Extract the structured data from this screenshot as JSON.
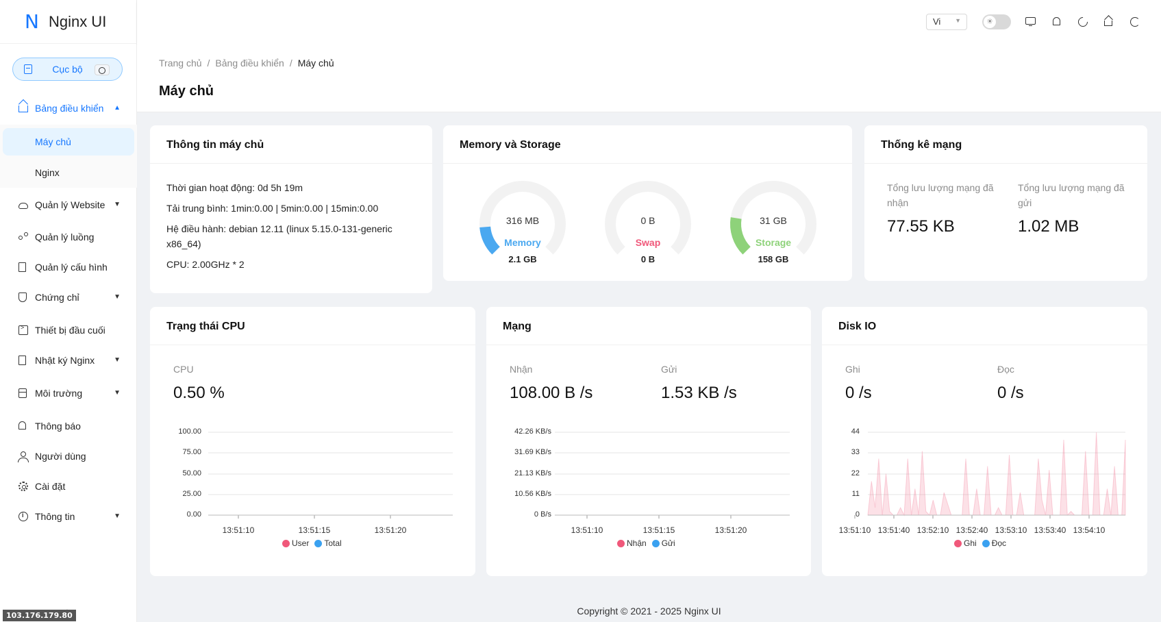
{
  "app": {
    "logo_letter": "N",
    "title": "Nginx UI"
  },
  "sidebar": {
    "node_label": "Cục bộ",
    "items": [
      {
        "label": "Bảng điều khiển",
        "icon": "home-icon",
        "open": true
      },
      {
        "label": "Máy chủ",
        "sub": true,
        "active": true
      },
      {
        "label": "Nginx",
        "sub": true
      },
      {
        "label": "Quản lý Website",
        "icon": "cloud-icon",
        "chevron": true
      },
      {
        "label": "Quản lý luồng",
        "icon": "share-icon"
      },
      {
        "label": "Quản lý cấu hình",
        "icon": "file-icon"
      },
      {
        "label": "Chứng chỉ",
        "icon": "shield-icon",
        "chevron": true
      },
      {
        "label": "Thiết bị đầu cuối",
        "icon": "terminal-icon"
      },
      {
        "label": "Nhật ký Nginx",
        "icon": "file-text-icon",
        "chevron": true
      },
      {
        "label": "Môi trường",
        "icon": "database-icon",
        "chevron": true
      },
      {
        "label": "Thông báo",
        "icon": "bell-icon"
      },
      {
        "label": "Người dùng",
        "icon": "user-icon"
      },
      {
        "label": "Cài đặt",
        "icon": "gear-icon"
      },
      {
        "label": "Thông tin",
        "icon": "info-icon",
        "chevron": true
      }
    ],
    "ip": "103.176.179.80"
  },
  "header": {
    "lang": "Vi"
  },
  "breadcrumb": [
    "Trang chủ",
    "Bảng điều khiển",
    "Máy chủ"
  ],
  "page_title": "Máy chủ",
  "server_info": {
    "title": "Thông tin máy chủ",
    "uptime": "Thời gian hoạt động: 0d 5h 19m",
    "load": "Tải trung bình: 1min:0.00 | 5min:0.00 | 15min:0.00",
    "os_line1": "Hệ điều hành: debian 12.11 (linux 5.15.0-131-generic",
    "os_line2": "x86_64)",
    "cpu": "CPU: 2.00GHz * 2"
  },
  "memory": {
    "title": "Memory và Storage",
    "gauges": [
      {
        "value": "316 MB",
        "name": "Memory",
        "total": "2.1 GB",
        "percent": 15,
        "color": "#4aa8f0"
      },
      {
        "value": "0 B",
        "name": "Swap",
        "total": "0 B",
        "percent": 0,
        "color": "#f0587a"
      },
      {
        "value": "31 GB",
        "name": "Storage",
        "total": "158 GB",
        "percent": 20,
        "color": "#8ed27a"
      }
    ]
  },
  "network_stats": {
    "title": "Thống kê mạng",
    "recv_label_1": "Tổng lưu lượng mạng đã",
    "recv_label_2": "nhận",
    "recv_value": "77.55 KB",
    "sent_label_1": "Tổng lưu lượng mạng đã",
    "sent_label_2": "gửi",
    "sent_value": "1.02 MB"
  },
  "cpu_card": {
    "title": "Trạng thái CPU",
    "label": "CPU",
    "value": "0.50 %",
    "y_ticks": [
      "100.00",
      "75.00",
      "50.00",
      "25.00",
      "0.00"
    ],
    "x_ticks": [
      "13:51:10",
      "13:51:15",
      "13:51:20"
    ],
    "legend": [
      {
        "name": "User",
        "color": "#f0587a"
      },
      {
        "name": "Total",
        "color": "#3aa1f0"
      }
    ]
  },
  "net_card": {
    "title": "Mạng",
    "recv_label": "Nhận",
    "recv_value": "108.00 B /s",
    "sent_label": "Gửi",
    "sent_value": "1.53 KB /s",
    "y_ticks": [
      "42.26 KB/s",
      "31.69 KB/s",
      "21.13 KB/s",
      "10.56 KB/s",
      "0 B/s"
    ],
    "x_ticks": [
      "13:51:10",
      "13:51:15",
      "13:51:20"
    ],
    "legend": [
      {
        "name": "Nhận",
        "color": "#f0587a"
      },
      {
        "name": "Gửi",
        "color": "#3aa1f0"
      }
    ]
  },
  "disk_card": {
    "title": "Disk IO",
    "write_label": "Ghi",
    "write_value": "0 /s",
    "read_label": "Đọc",
    "read_value": "0 /s",
    "y_ticks": [
      "44",
      "33",
      "22",
      "11",
      "0"
    ],
    "x_ticks": [
      "13:51:10",
      "13:51:40",
      "13:52:10",
      "13:52:40",
      "13:53:10",
      "13:53:40",
      "13:54:10"
    ],
    "legend": [
      {
        "name": "Ghi",
        "color": "#f0587a"
      },
      {
        "name": "Đọc",
        "color": "#3aa1f0"
      }
    ]
  },
  "chart_data": {
    "type": "area",
    "title": "Disk IO",
    "x": [
      "13:51:10",
      "13:51:40",
      "13:52:10",
      "13:52:40",
      "13:53:10",
      "13:53:40",
      "13:54:10"
    ],
    "ylim": [
      0,
      44
    ],
    "series": [
      {
        "name": "Ghi",
        "values": [
          0,
          18,
          4,
          30,
          0,
          22,
          2,
          0,
          0,
          4,
          0,
          30,
          0,
          14,
          0,
          34,
          2,
          0,
          8,
          0,
          0,
          12,
          6,
          0,
          0,
          0,
          0,
          30,
          0,
          0,
          14,
          0,
          0,
          26,
          0,
          0,
          4,
          0,
          0,
          32,
          0,
          0,
          12,
          0,
          0,
          0,
          0,
          30,
          8,
          0,
          24,
          0,
          0,
          0,
          40,
          0,
          2,
          0,
          0,
          0,
          34,
          0,
          0,
          44,
          0,
          0,
          14,
          0,
          26,
          0,
          0,
          40
        ]
      },
      {
        "name": "Đọc",
        "values": [
          0,
          0,
          0,
          0,
          0,
          0,
          0,
          0,
          0,
          0,
          0,
          0,
          0,
          0,
          0,
          0,
          0,
          0,
          0,
          0,
          0,
          0,
          0,
          0,
          0,
          0,
          0,
          0,
          0,
          0,
          0,
          0,
          0,
          0,
          0,
          0,
          0,
          0,
          0,
          0,
          0,
          0,
          0,
          0,
          0,
          0,
          0,
          0,
          0,
          0,
          0,
          0,
          0,
          0,
          0,
          0,
          0,
          0,
          0,
          0,
          0,
          0,
          0,
          0,
          0,
          0,
          0,
          0,
          0,
          0,
          0,
          0
        ]
      }
    ]
  },
  "footer": "Copyright © 2021 - 2025 Nginx UI"
}
